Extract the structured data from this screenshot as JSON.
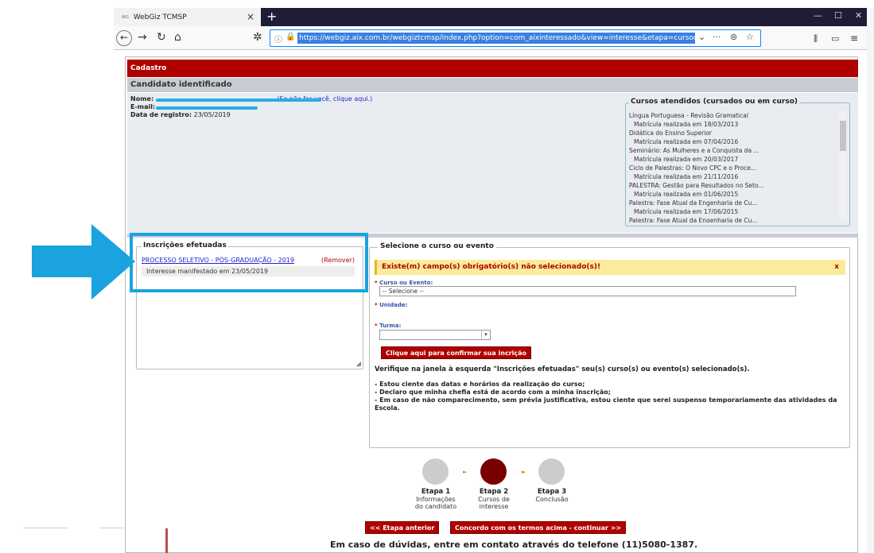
{
  "browser": {
    "tab_title": "WebGiz TCMSP",
    "tab_favicon_text": "WG",
    "url": "https://webgiz.aix.com.br/webgiztcmsp/index.php?option=com_aixinteressado&view=interesse&etapa=cursodeintere"
  },
  "header": {
    "section": "Cadastro",
    "subsection": "Candidato identificado"
  },
  "candidate": {
    "name_label": "Nome:",
    "not_you_link": "(Se não for você, clique aqui.)",
    "email_label": "E-mail:",
    "reg_label": "Data de registro:",
    "reg_date": "23/05/2019"
  },
  "courses": {
    "title": "Cursos atendidos (cursados ou em curso)",
    "items": [
      {
        "name": "Língua Portuguesa - Revisão Gramatical",
        "info": "Matrícula realizada em 18/03/2013"
      },
      {
        "name": "Didática do Ensino Superior",
        "info": "Matrícula realizada em 07/04/2016"
      },
      {
        "name": "Seminário: As Mulheres e a Conquista da ...",
        "info": "Matrícula realizada em 20/03/2017"
      },
      {
        "name": "Ciclo de Palestras: O Novo CPC e o Proce...",
        "info": "Matrícula realizada em 21/11/2016"
      },
      {
        "name": "PALESTRA: Gestão para Resultados no Seto...",
        "info": "Matrícula realizada em 01/06/2015"
      },
      {
        "name": "Palestra: Fase Atual da Engenharia de Cu...",
        "info": "Matrícula realizada em 17/06/2015"
      },
      {
        "name": "Palestra: Fase Atual da Engenharia de Cu...",
        "info": ""
      }
    ]
  },
  "enrollments": {
    "title": "Inscrições efetuadas",
    "item": "PROCESSO SELETIVO - PÓS-GRADUAÇÃO - 2019",
    "remove": "(Remover)",
    "info": "Interesse manifestado em 23/05/2019"
  },
  "selector": {
    "title": "Selecione o curso ou evento",
    "alert": "Existe(m) campo(s) obrigatório(s) não selecionado(s)!",
    "alert_close": "x",
    "course_label": "Curso ou Evento:",
    "course_value": "-- Selecione --",
    "unit_label": "Unidade:",
    "class_label": "Turma:",
    "required_mark": "*",
    "confirm_button": "Clique aqui para confirmar sua incrição",
    "verify_text": "Verifique na janela à esquerda \"Inscrições efetuadas\" seu(s) curso(s) ou evento(s) selecionado(s).",
    "terms": [
      "- Estou ciente das datas e horários da realização do curso;",
      "- Declaro que minha chefia está de acordo com a minha inscrição;",
      "- Em caso de não comparecimento, sem prévia justificativa, estou ciente que serei suspenso temporariamente das atividades da Escola."
    ]
  },
  "steps": [
    {
      "title": "Etapa 1",
      "line1": "Informações",
      "line2": "do candidato"
    },
    {
      "title": "Etapa 2",
      "line1": "Cursos de",
      "line2": "interesse"
    },
    {
      "title": "Etapa 3",
      "line1": "Conclusão",
      "line2": ""
    }
  ],
  "navigation": {
    "prev": "<< Etapa anterior",
    "next": "Concordo com os termos acima - continuar >>"
  },
  "footer": "Em caso de dúvidas, entre em contato através do telefone (11)5080-1387.",
  "colors": {
    "brand_red": "#b00000",
    "step_active": "#7a0000",
    "highlight_blue": "#1aa3df"
  }
}
